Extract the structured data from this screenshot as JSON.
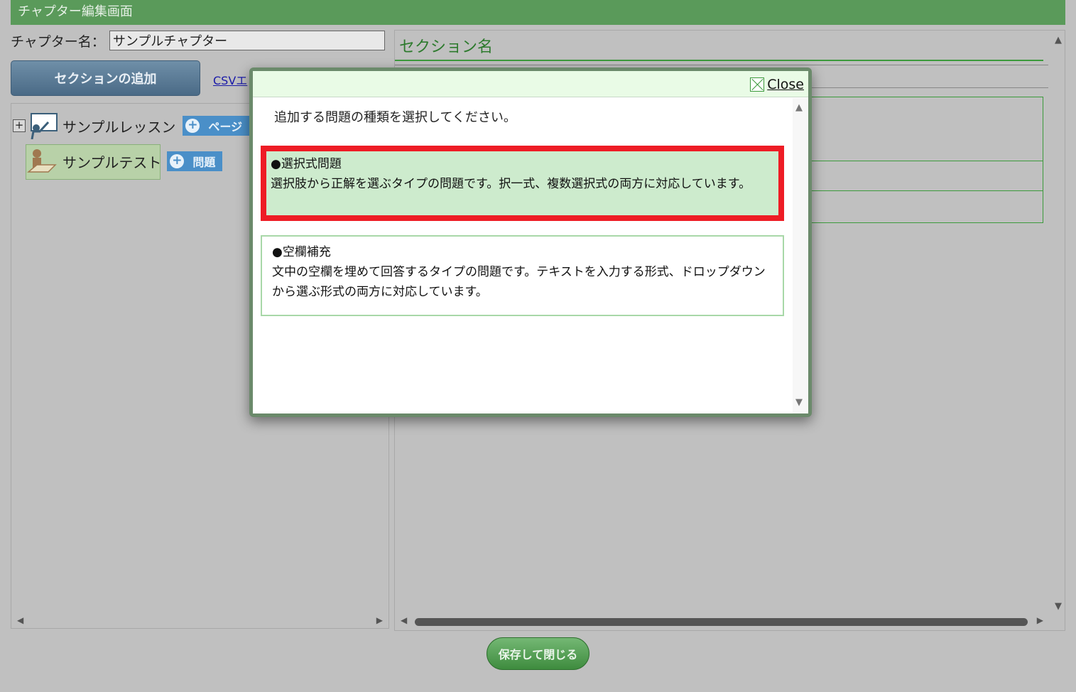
{
  "window": {
    "title": "チャプター編集画面"
  },
  "chapter": {
    "name_label": "チャプター名：",
    "name_value": "サンプルチャプター"
  },
  "toolbar": {
    "add_section_label": "セクションの追加",
    "csv_link": "CSVエ"
  },
  "tree": {
    "lesson": {
      "label": "サンプルレッスン",
      "page_button": "ページ"
    },
    "test": {
      "label": "サンプルテスト",
      "question_button": "問題"
    }
  },
  "section": {
    "heading": "セクション名"
  },
  "footer": {
    "save_close_label": "保存して閉じる"
  },
  "modal": {
    "close_label": "Close",
    "prompt": "追加する問題の種類を選択してください。",
    "options": [
      {
        "title": "●選択式問題",
        "description": "選択肢から正解を選ぶタイプの問題です。択一式、複数選択式の両方に対応しています。"
      },
      {
        "title": "●空欄補充",
        "description": "文中の空欄を埋めて回答するタイプの問題です。テキストを入力する形式、ドロップダウンから選ぶ形式の両方に対応しています。"
      }
    ]
  },
  "colors": {
    "accent_green": "#5a9a5a",
    "highlight_red": "#ee1c25",
    "selected_bg": "#cdebcd",
    "button_blue": "#4a8fc8"
  }
}
